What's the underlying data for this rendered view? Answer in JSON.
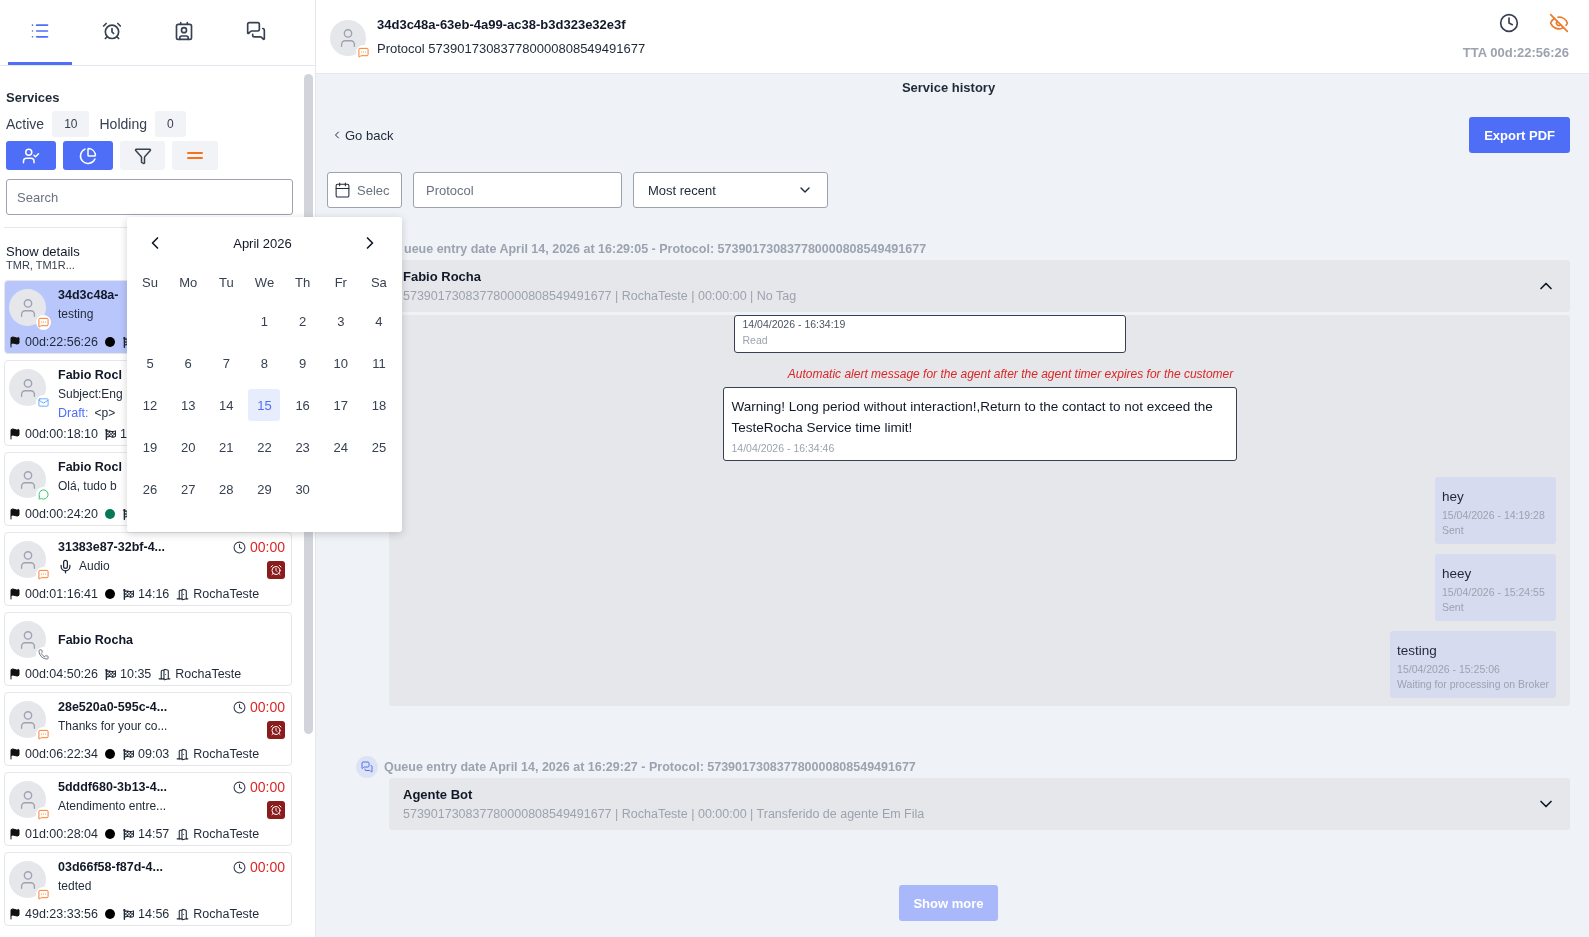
{
  "sidebar": {
    "tabs": [
      {
        "selected": true
      },
      {
        "selected": false
      },
      {
        "selected": false
      },
      {
        "selected": false
      }
    ],
    "services": {
      "title": "Services",
      "counters": [
        {
          "label": "Active",
          "value": "10"
        },
        {
          "label": "Holding",
          "value": "0"
        }
      ],
      "actions": [
        {
          "selected": true
        },
        {
          "selected": true
        },
        {
          "selected": false
        },
        {
          "selected": false
        }
      ]
    },
    "search": {
      "placeholder": "Search"
    },
    "details": {
      "title": "Show details",
      "subtitle": "TMR, TM1R..."
    },
    "cards": [
      {
        "kind": "chat",
        "title": "34d3c48a-",
        "message": "testing",
        "elapsed": "00d:22:56:26",
        "color": "#000000",
        "selected": true
      },
      {
        "kind": "email",
        "title": "Fabio Rocl",
        "message": "Subject:Eng",
        "draft_label": "Draft:",
        "draft": "<p>",
        "elapsed": "00d:00:18:10",
        "finish_time": "1",
        "selected": false
      },
      {
        "kind": "whatsapp",
        "title": "Fabio Rocl",
        "message": "Olá, tudo b",
        "elapsed": "00d:00:24:20",
        "color": "#047857",
        "selected": false
      },
      {
        "kind": "chat",
        "title": "31383e87-32bf-4...",
        "message": "Audio",
        "audio": true,
        "timer": "00:00",
        "alarm": true,
        "elapsed": "00d:01:16:41",
        "color": "#000000",
        "finish_time": "14:16",
        "queue": "RochaTeste",
        "selected": false
      },
      {
        "kind": "phone",
        "title": "Fabio Rocha",
        "elapsed": "00d:04:50:26",
        "finish_time": "10:35",
        "queue": "RochaTeste",
        "selected": false
      },
      {
        "kind": "chat",
        "title": "28e520a0-595c-4...",
        "message": "Thanks for your co...",
        "timer": "00:00",
        "alarm": true,
        "elapsed": "00d:06:22:34",
        "color": "#000000",
        "finish_time": "09:03",
        "queue": "RochaTeste",
        "selected": false
      },
      {
        "kind": "chat",
        "title": "5dddf680-3b13-4...",
        "message": "Atendimento entre...",
        "timer": "00:00",
        "alarm": true,
        "elapsed": "01d:00:28:04",
        "color": "#000000",
        "finish_time": "14:57",
        "queue": "RochaTeste",
        "selected": false
      },
      {
        "kind": "chat",
        "title": "03d66f58-f87d-4...",
        "message": "tedted",
        "timer": "00:00",
        "alarm": false,
        "elapsed": "49d:23:33:56",
        "color": "#000000",
        "finish_time": "14:56",
        "queue": "RochaTeste",
        "selected": false
      }
    ]
  },
  "calendar": {
    "month": "April 2026",
    "weekdays": [
      "Su",
      "Mo",
      "Tu",
      "We",
      "Th",
      "Fr",
      "Sa"
    ],
    "days": [
      {
        "day": "1",
        "selected": false
      },
      {
        "day": "2",
        "selected": false
      },
      {
        "day": "3",
        "selected": false
      },
      {
        "day": "4",
        "selected": false
      },
      {
        "day": "5",
        "selected": false
      },
      {
        "day": "6",
        "selected": false
      },
      {
        "day": "7",
        "selected": false
      },
      {
        "day": "8",
        "selected": false
      },
      {
        "day": "9",
        "selected": false
      },
      {
        "day": "10",
        "selected": false
      },
      {
        "day": "11",
        "selected": false
      },
      {
        "day": "12",
        "selected": false
      },
      {
        "day": "13",
        "selected": false
      },
      {
        "day": "14",
        "selected": false
      },
      {
        "day": "15",
        "selected": true
      },
      {
        "day": "16",
        "selected": false
      },
      {
        "day": "17",
        "selected": false
      },
      {
        "day": "18",
        "selected": false
      },
      {
        "day": "19",
        "selected": false
      },
      {
        "day": "20",
        "selected": false
      },
      {
        "day": "21",
        "selected": false
      },
      {
        "day": "22",
        "selected": false
      },
      {
        "day": "23",
        "selected": false
      },
      {
        "day": "24",
        "selected": false
      },
      {
        "day": "25",
        "selected": false
      },
      {
        "day": "26",
        "selected": false
      },
      {
        "day": "27",
        "selected": false
      },
      {
        "day": "28",
        "selected": false
      },
      {
        "day": "29",
        "selected": false
      },
      {
        "day": "30",
        "selected": false
      }
    ]
  },
  "header": {
    "kind": "chat",
    "title": "34d3c48a-63eb-4a99-ac38-b3d323e32e3f",
    "protocol": "Protocol 573901730837780000808549491677",
    "tta": "TTA 00d:22:56:26"
  },
  "history": {
    "title": "Service history",
    "back": "Go back",
    "export": "Export PDF",
    "filters": {
      "date_placeholder": "Selec",
      "protocol_placeholder": "Protocol",
      "order": "Most recent"
    },
    "entries": [
      {
        "queue_text": "ueue entry date April 14, 2026 at 16:29:05 - Protocol: 573901730837780000808549491677",
        "name": "Fabio Rocha",
        "info": "573901730837780000808549491677 | RochaTeste | 00:00:00 | No Tag",
        "expanded": true,
        "messages": [
          {
            "kind": "system",
            "time": "14/04/2026 - 16:34:19",
            "status": "Read"
          },
          {
            "kind": "alert",
            "text": "Automatic alert message for the agent after the agent timer expires for the customer"
          },
          {
            "kind": "system",
            "text": "Warning! Long period without interaction!,Return to the contact to not exceed the TesteRocha Service time limit!",
            "time": "14/04/2026 - 16:34:46"
          },
          {
            "kind": "sent",
            "text": "hey",
            "time": "15/04/2026 - 14:19:28",
            "status": "Sent"
          },
          {
            "kind": "sent",
            "text": "heey",
            "time": "15/04/2026 - 15:24:55",
            "status": "Sent"
          },
          {
            "kind": "sent",
            "text": "testing",
            "time": "15/04/2026 - 15:25:06",
            "status": "Waiting for processing on Broker"
          }
        ]
      },
      {
        "queue_text": "Queue entry date April 14, 2026 at 16:29:27 - Protocol: 573901730837780000808549491677",
        "name": "Agente Bot",
        "info": "573901730837780000808549491677 | RochaTeste | 00:00:00 | Transferido de agente Em Fila",
        "expanded": false
      }
    ],
    "show_more": {
      "label": "Show more",
      "disabled": true
    }
  }
}
